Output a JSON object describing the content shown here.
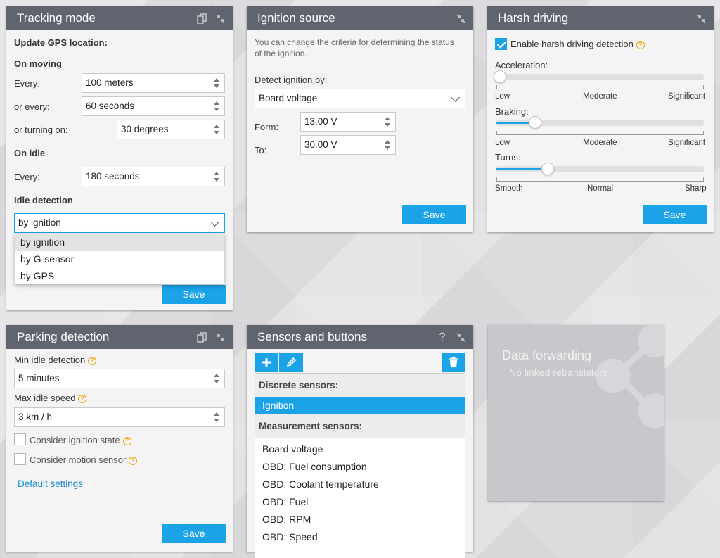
{
  "tracking": {
    "title": "Tracking mode",
    "update_gps": "Update GPS location:",
    "on_moving": "On moving",
    "every_label": "Every:",
    "every_value": "100  meters",
    "or_every_label": "or every:",
    "or_every_value": "60  seconds",
    "turning_label": "or turning on:",
    "turning_value": "30  degrees",
    "on_idle": "On idle",
    "idle_every_label": "Every:",
    "idle_every_value": "180  seconds",
    "idle_detection": "Idle detection",
    "idle_select": "by ignition",
    "options": [
      "by ignition",
      "by G-sensor",
      "by GPS"
    ],
    "save": "Save"
  },
  "ignition": {
    "title": "Ignition source",
    "description": "You can change the criteria for determining the status of the ignition.",
    "detect_label": "Detect ignition by:",
    "detect_value": "Board voltage",
    "form_label": "Form:",
    "form_value": "13.00  V",
    "to_label": "To:",
    "to_value": "30.00  V",
    "save": "Save"
  },
  "harsh": {
    "title": "Harsh driving",
    "enable_label": "Enable harsh driving detection",
    "enabled": true,
    "acceleration": {
      "label": "Acceleration:",
      "level": 0.0,
      "low": "Low",
      "mid": "Moderate",
      "high": "Significant"
    },
    "braking": {
      "label": "Braking:",
      "level": 0.17,
      "low": "Low",
      "mid": "Moderate",
      "high": "Significant"
    },
    "turns": {
      "label": "Turns:",
      "level": 0.23,
      "low": "Smooth",
      "mid": "Normal",
      "high": "Sharp"
    },
    "save": "Save"
  },
  "parking": {
    "title": "Parking detection",
    "min_idle_label": "Min idle detection",
    "min_idle_value": "5  minutes",
    "max_speed_label": "Max idle speed",
    "max_speed_value": "3  km / h",
    "ignition_state_label": "Consider ignition state",
    "motion_sensor_label": "Consider motion sensor",
    "default_link": "Default settings",
    "save": "Save"
  },
  "sensors": {
    "title": "Sensors and buttons",
    "help": "?",
    "discrete_header": "Discrete sensors:",
    "discrete": [
      "Ignition"
    ],
    "measurement_header": "Measurement sensors:",
    "measurement": [
      "Board voltage",
      "OBD: Fuel consumption",
      "OBD: Coolant temperature",
      "OBD: Fuel",
      "OBD: RPM",
      "OBD: Speed"
    ]
  },
  "forwarding": {
    "title": "Data forwarding",
    "subtitle": "No linked retranslators"
  },
  "colors": {
    "accent": "#1aa3e6",
    "header": "#5f646e",
    "warning": "#f0a800"
  }
}
